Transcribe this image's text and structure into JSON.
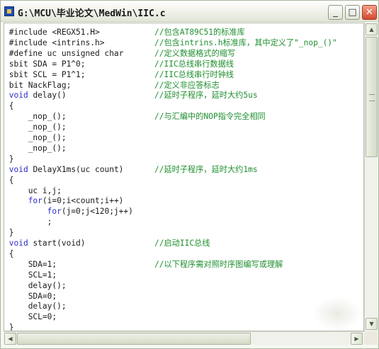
{
  "window": {
    "title": "G:\\MCU\\毕业论文\\MedWin\\IIC.c"
  },
  "controls": {
    "minimize": "_",
    "maximize": "□",
    "close": "✕"
  },
  "scroll": {
    "up": "▲",
    "down": "▼",
    "left": "◀",
    "right": "▶"
  },
  "code_lines": [
    {
      "code": "#include <REGX51.H>",
      "comment": "//包含AT89C51的标准库",
      "kw": ""
    },
    {
      "code": "#include <intrins.h>",
      "comment": "//包含intrins.h标准库，其中定义了\"_nop_()\"",
      "kw": ""
    },
    {
      "code": "#define uc unsigned char",
      "comment": "//定义数据格式的缩写",
      "kw": ""
    },
    {
      "code": "sbit SDA = P1^0;",
      "comment": "//IIC总线串行数据线",
      "kw": ""
    },
    {
      "code": "sbit SCL = P1^1;",
      "comment": "//IIC总线串行时钟线",
      "kw": ""
    },
    {
      "code": "bit NackFlag;",
      "comment": "//定义非应答标志",
      "kw": ""
    },
    {
      "code": " delay()",
      "comment": "//延时子程序，延时大约5us",
      "kw": "void"
    },
    {
      "code": "{",
      "comment": "",
      "kw": ""
    },
    {
      "code": "    _nop_();",
      "comment": "//与汇编中的NOP指令完全相同",
      "kw": ""
    },
    {
      "code": "    _nop_();",
      "comment": "",
      "kw": ""
    },
    {
      "code": "    _nop_();",
      "comment": "",
      "kw": ""
    },
    {
      "code": "    _nop_();",
      "comment": "",
      "kw": ""
    },
    {
      "code": "}",
      "comment": "",
      "kw": ""
    },
    {
      "code": " DelayX1ms(uc count)",
      "comment": "//延时子程序，延时大约1ms",
      "kw": "void"
    },
    {
      "code": "{",
      "comment": "",
      "kw": ""
    },
    {
      "code": "    uc i,j;",
      "comment": "",
      "kw": ""
    },
    {
      "code": "(i=0;i<count;i++)",
      "comment": "",
      "kw": "    for"
    },
    {
      "code": "(j=0;j<120;j++)",
      "comment": "",
      "kw": "        for"
    },
    {
      "code": "        ;",
      "comment": "",
      "kw": ""
    },
    {
      "code": "}",
      "comment": "",
      "kw": ""
    },
    {
      "code": " start(void)",
      "comment": "//启动IIC总线",
      "kw": "void"
    },
    {
      "code": "{",
      "comment": "",
      "kw": ""
    },
    {
      "code": "    SDA=1;",
      "comment": "//以下程序需对照时序图编写或理解",
      "kw": ""
    },
    {
      "code": "    SCL=1;",
      "comment": "",
      "kw": ""
    },
    {
      "code": "    delay();",
      "comment": "",
      "kw": ""
    },
    {
      "code": "    SDA=0;",
      "comment": "",
      "kw": ""
    },
    {
      "code": "    delay();",
      "comment": "",
      "kw": ""
    },
    {
      "code": "    SCL=0;",
      "comment": "",
      "kw": ""
    },
    {
      "code": "}",
      "comment": "",
      "kw": ""
    }
  ],
  "colors": {
    "keyword": "#2c2cc8",
    "comment": "#1f8f2f",
    "text": "#1a1a1a"
  }
}
